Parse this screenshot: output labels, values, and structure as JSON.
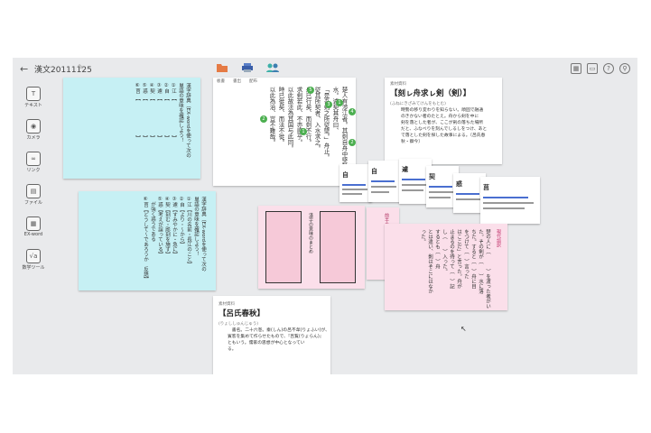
{
  "window": {
    "title": "漢文20111125",
    "back": "←"
  },
  "sidebar": [
    {
      "label": "テキスト",
      "glyph": "T"
    },
    {
      "label": "カメラ",
      "glyph": "◉"
    },
    {
      "label": "リンク",
      "glyph": "∞"
    },
    {
      "label": "ファイル",
      "glyph": "▤"
    },
    {
      "label": "EX-word",
      "glyph": "▦"
    },
    {
      "label": "数学ツール",
      "glyph": "√a"
    }
  ],
  "cards": {
    "card1": "漢字辞典（EX-wordを使って次の\n単語の意味を確認しよう！\n①江　【　　　　　　　】\n②自　【　　　　　　　】\n③遽　【　　　　　　　】\n④契　【　　　　　　　】\n⑤惑　【　　　　　　　】\n⑥莒　【　　　　　　　】",
    "card2": "漢字辞典（EX-wordを使って次の\n単語の意味を確認しよう！\n①江【川の名前・長江のこと】\n②自【より・〜から】\n③遽【すみやかに・急に】\n④契【刻む・彫刻を施す】\n⑤惑【考えが誤っている】\n　が強く惑うである\n⑥莒【どうして〜であろうか　反語】",
    "text_tabs": [
      "板書",
      "書出",
      "配布"
    ],
    "text_main": "楚人有渉江者。其剣自舟中墜於\n水。遽契其舟曰、\n「是吾剣之所従墜。」舟止。\n従其所契者、入水求之。\n舟已行矣、而剣不行。\n求剣若此、不亦惑乎。\n以此故法為其国与此同。\n時已徙矣、而法不徙。\n以此為治、豈不難哉。",
    "text_numbers": [
      "4",
      "1",
      "2",
      "3",
      "5",
      "1",
      "2"
    ],
    "sozai_tag": "素材資料",
    "sozai_title": "【刻ㇾ舟求ㇾ剣（剣）】",
    "sozai_reading": "(ふねにきざみてけんをもとむ)",
    "sozai_body": "時勢の移り変わりを知らない。頑固で融通\nのきかない者のたとえ。舟から剣を中に\n剣を落とした者が、ここが剣の落ちた場所\nだと、ふなべりを刻んでしるしをつけ、あと\nで落とした剣を探した故事による。〔呂氏春\n秋・察今〕",
    "minis": [
      "自",
      "遽",
      "契",
      "惑",
      "莒"
    ],
    "boxes_label": "漢字の意味のまとめ",
    "pink_label": "前半のことを調べよう",
    "pink3_title": "現代語訳",
    "pink3_body": "楚の人に（　　　）を渡った者がい\nた。その剣が（　　）水に落\nちた。すると（　）舟に目\nをつけて（　）言った\nはここだ」と言った。舟が\n止まるのを待って（　）記\nし（　　）入った。\nするとも（　）舟\nとは違い、剣はそこにはなか\nった。",
    "ryoshi_tag": "素材資料",
    "ryoshi_title": "【呂氏春秋】",
    "ryoshi_reading": "(りょししゅんじゅう)",
    "ryoshi_body": "　書名。二十六巻。秦(しん)の呂不韋(りょふい)が、\n賓客を集めて作らせたもので、『呂覧(りょらん)』\nともいう。儒家の思想が中心となってい\nる。"
  },
  "colors": {
    "accent_green": "#4caf50",
    "cyan_card": "#c6f0f4",
    "pink_card": "#fbdfea",
    "canvas": "#e9eaec"
  }
}
